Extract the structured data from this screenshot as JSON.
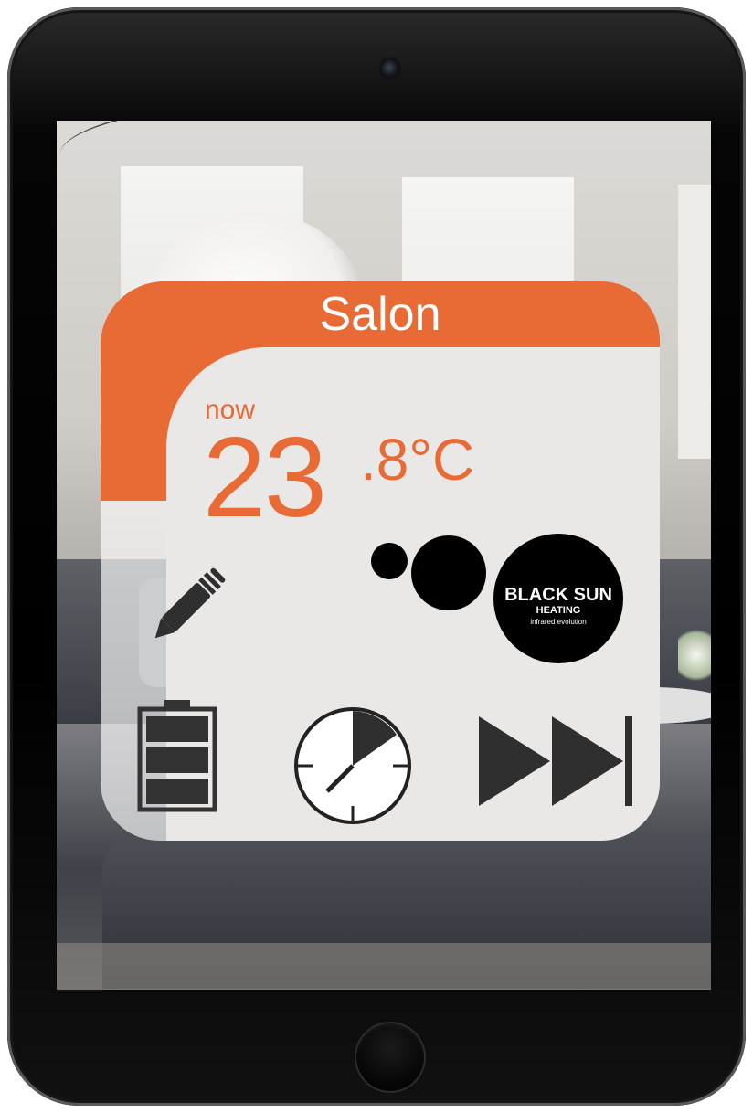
{
  "widget": {
    "room_name": "Salon",
    "now_label": "now",
    "temperature_integer": "23",
    "temperature_decimal": ".8°C",
    "accent_color": "#e86a35"
  },
  "brand": {
    "name": "BLACK SUN",
    "subtitle": "HEATING",
    "tagline": "infrared evolution"
  },
  "controls": [
    {
      "name": "edit",
      "icon": "pencil-icon"
    },
    {
      "name": "battery",
      "icon": "battery-icon"
    },
    {
      "name": "timer",
      "icon": "clock-icon"
    },
    {
      "name": "skip",
      "icon": "fast-forward-end-icon"
    }
  ]
}
